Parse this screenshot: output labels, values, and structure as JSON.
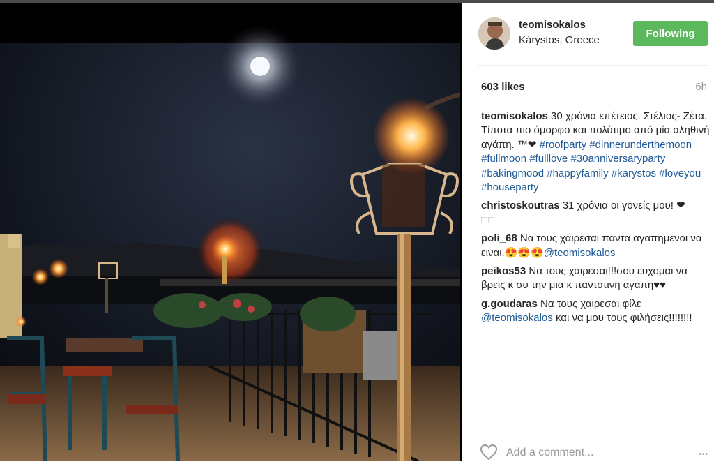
{
  "post": {
    "username": "teomisokalos",
    "location": "Kárystos, Greece",
    "follow_label": "Following",
    "likes": "603 likes",
    "time": "6h"
  },
  "caption": {
    "user": "teomisokalos",
    "text": "30 χρόνια επέτειος. Στέλιος- Ζέτα. Τίποτα πιο όμορφο και πολύτιμο από μία αληθινή αγάπη. ™❤",
    "tags": [
      "#roofparty",
      "#dinnerunderthemoon",
      "#fullmoon",
      "#fulllove",
      "#30anniversaryparty",
      "#bakingmood",
      "#happyfamily",
      "#karystos",
      "#loveyou",
      "#houseparty"
    ]
  },
  "comments": [
    {
      "user": "christoskoutras",
      "text": "31 χρόνια οι γονείς μου! ❤",
      "extra": "□□"
    },
    {
      "user": "poli_68",
      "text": "Να τους χαιρεσαι παντα αγαπημενοι να ειναι.😍😍😍",
      "mention": "@teomisokalos"
    },
    {
      "user": "peikos53",
      "text": "Να τους χαιρεσαι!!!σου ευχομαι να βρεις κ συ την μια κ παντοτινη αγαπη♥♥"
    },
    {
      "user": "g.goudaras",
      "text": "Να τους χαιρεσαι φίλε",
      "mention": "@teomisokalos",
      "text2": "και να μου τους φιλήσεις!!!!!!!!"
    }
  ],
  "footer": {
    "add_comment_placeholder": "Add a comment...",
    "more_label": "•••",
    "heart_icon": "heart-outline-icon"
  }
}
